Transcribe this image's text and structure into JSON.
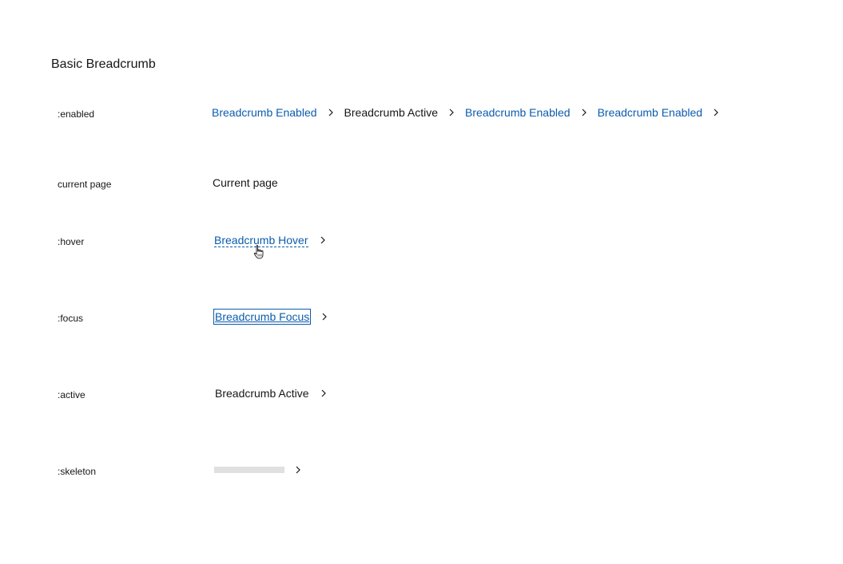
{
  "page": {
    "title": "Basic Breadcrumb"
  },
  "rows": {
    "enabled": {
      "label": ":enabled",
      "items": [
        {
          "text": "Breadcrumb Enabled",
          "type": "link"
        },
        {
          "text": "Breadcrumb Active",
          "type": "plain"
        },
        {
          "text": "Breadcrumb Enabled",
          "type": "link"
        },
        {
          "text": "Breadcrumb Enabled",
          "type": "link"
        }
      ]
    },
    "current": {
      "label": "current page",
      "text": "Current page"
    },
    "hover": {
      "label": ":hover",
      "text": "Breadcrumb Hover"
    },
    "focus": {
      "label": ":focus",
      "text": "Breadcrumb Focus"
    },
    "active": {
      "label": ":active",
      "text": "Breadcrumb Active"
    },
    "skeleton": {
      "label": ":skeleton"
    }
  },
  "icons": {
    "separator": "chevron-right-icon",
    "cursor": "hand-pointer-icon"
  },
  "colors": {
    "link": "#0b5cad",
    "text": "#161616",
    "skeleton": "#e0e0e0"
  }
}
